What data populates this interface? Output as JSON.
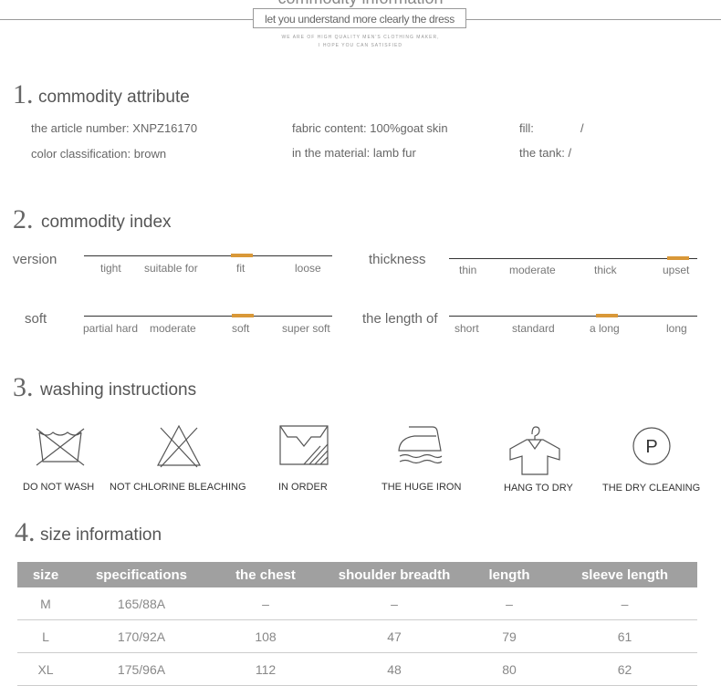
{
  "header": {
    "title": "commodity information",
    "subtitle": "let you understand more clearly the dress",
    "small_line1": "WE ARE OF HIGH QUALITY MEN'S CLOTHING MAKER,",
    "small_line2": "I HOPE YOU CAN SATISFIED"
  },
  "sections": {
    "attribute": {
      "num": "1.",
      "title": "commodity attribute"
    },
    "index": {
      "num": "2.",
      "title": "commodity index"
    },
    "washing": {
      "num": "3.",
      "title": "washing instructions"
    },
    "size": {
      "num": "4.",
      "title": "size information"
    }
  },
  "attributes": {
    "article_number": "the article number:  XNPZ16170",
    "fabric": "fabric content: 100%goat skin",
    "fill": "fill:",
    "fill_value": "/",
    "color": "color classification:  brown",
    "material": "in the material:  lamb fur",
    "tank": "the tank:  /"
  },
  "index": {
    "version": {
      "name": "version",
      "labels": [
        "tight",
        "suitable for",
        "fit",
        "loose"
      ],
      "selected": "fit"
    },
    "thickness": {
      "name": "thickness",
      "labels": [
        "thin",
        "moderate",
        "thick",
        "upset"
      ],
      "selected": "upset"
    },
    "soft": {
      "name": "soft",
      "labels": [
        "partial hard",
        "moderate",
        "soft",
        "super soft"
      ],
      "selected": "soft"
    },
    "length": {
      "name": "the length of",
      "labels": [
        "short",
        "standard",
        "a long",
        "long"
      ],
      "selected": "a long"
    },
    "accent_color": "#d99838"
  },
  "washing": {
    "items": [
      {
        "icon": "do-not-wash-icon",
        "label": "DO NOT WASH"
      },
      {
        "icon": "no-chlorine-icon",
        "label": "NOT CHLORINE BLEACHING"
      },
      {
        "icon": "in-order-icon",
        "label": "IN ORDER"
      },
      {
        "icon": "iron-icon",
        "label": "THE HUGE IRON"
      },
      {
        "icon": "hang-dry-icon",
        "label": "HANG TO DRY"
      },
      {
        "icon": "dry-clean-icon",
        "label": "THE DRY CLEANING"
      }
    ],
    "dry_clean_letter": "P"
  },
  "size_table": {
    "headers": [
      "size",
      "specifications",
      "the chest",
      "shoulder breadth",
      "length",
      "sleeve length"
    ],
    "rows": [
      [
        "M",
        "165/88A",
        "–",
        "–",
        "–",
        "–"
      ],
      [
        "L",
        "170/92A",
        "108",
        "47",
        "79",
        "61"
      ],
      [
        "XL",
        "175/96A",
        "112",
        "48",
        "80",
        "62"
      ]
    ]
  }
}
